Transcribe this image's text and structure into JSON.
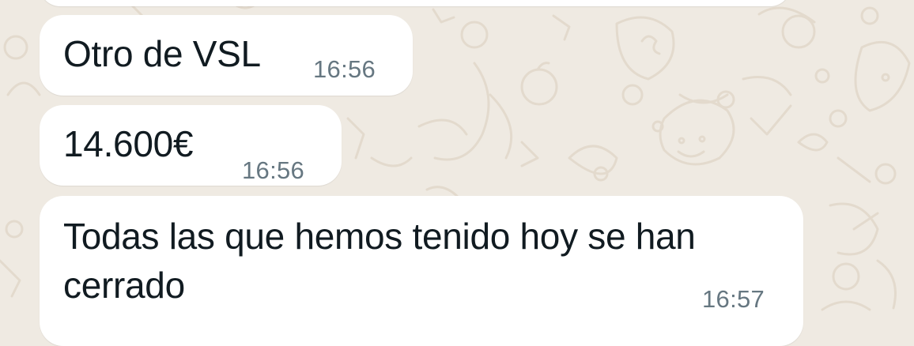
{
  "chat": {
    "messages": [
      {
        "text": "Otro de VSL",
        "time": "16:56"
      },
      {
        "text": "14.600€",
        "time": "16:56"
      },
      {
        "text": "Todas las que hemos tenido hoy se han\ncerrado",
        "time": "16:57"
      }
    ]
  },
  "colors": {
    "background": "#efeae2",
    "bubble": "#ffffff",
    "text": "#111b21",
    "timestamp": "#667781",
    "doodle": "#e2d9cc"
  }
}
